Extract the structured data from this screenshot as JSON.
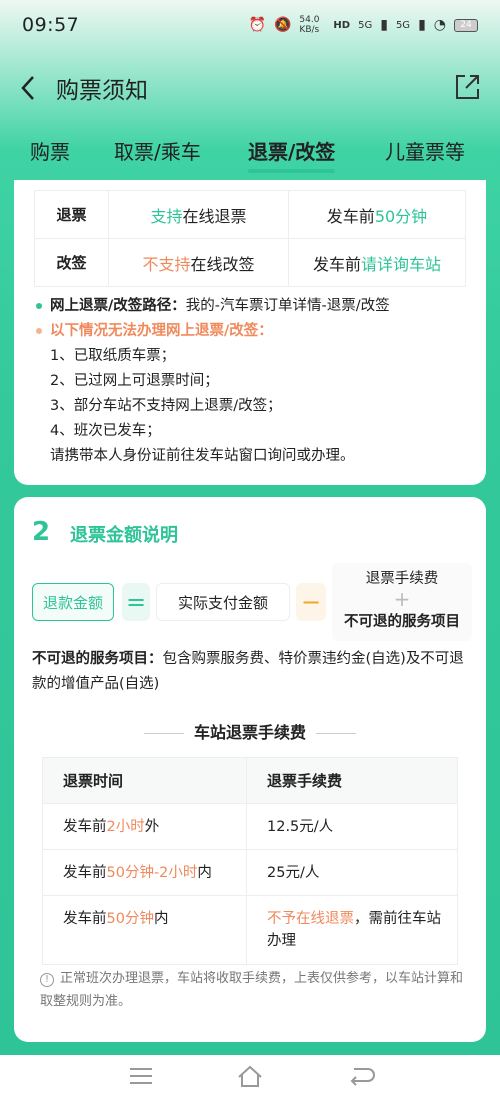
{
  "status": {
    "time": "09:57",
    "speed": "54.0 KB/s",
    "hd": "HD",
    "net1": "5G",
    "net2": "5G",
    "battery": "24"
  },
  "header": {
    "title": "购票须知"
  },
  "tabs": [
    {
      "label": "购票",
      "active": false
    },
    {
      "label": "取票/乘车",
      "active": false
    },
    {
      "label": "退票/改签",
      "active": true
    },
    {
      "label": "儿童票等",
      "active": false
    }
  ],
  "rules": {
    "refund_key": "退票",
    "refund_v1_hl": "支持",
    "refund_v1_rest": "在线退票",
    "refund_v2_pre": "发车前",
    "refund_v2_hl": "50分钟",
    "change_key": "改签",
    "change_v1_hl": "不支持",
    "change_v1_rest": "在线改签",
    "change_v2_pre": "发车前",
    "change_v2_hl": "请详询车站"
  },
  "notes": {
    "path_label": "网上退票/改签路径：",
    "path_value": "我的-汽车票订单详情-退票/改签",
    "cannot_title": "以下情况无法办理网上退票/改签：",
    "items": [
      "1、已取纸质车票；",
      "2、已过网上可退票时间；",
      "3、部分车站不支持网上退票/改签；",
      "4、班次已发车；"
    ],
    "footer": "请携带本人身份证前往发车站窗口询问或办理。"
  },
  "section2": {
    "num": "2",
    "title": "退票金额说明",
    "refund_amount": "退款金额",
    "eq": "=",
    "paid": "实际支付金额",
    "minus": "−",
    "fee": "退票手续费",
    "plus": "+",
    "nonrefundable": "不可退的服务项目",
    "nonref_label": "不可退的服务项目：",
    "nonref_text": "包含购票服务费、特价票违约金(自选)及不可退款的增值产品(自选)",
    "station_fee_title": "车站退票手续费",
    "fee_table": {
      "headers": [
        "退票时间",
        "退票手续费"
      ],
      "rows": [
        {
          "t_pre": "发车前",
          "t_hl": "2小时",
          "t_post": "外",
          "fee_hl": "",
          "fee": "12.5元/人"
        },
        {
          "t_pre": "发车前",
          "t_hl": "50分钟-2小时",
          "t_post": "内",
          "fee_hl": "",
          "fee": "25元/人"
        },
        {
          "t_pre": "发车前",
          "t_hl": "50分钟",
          "t_post": "内",
          "fee_hl": "不予在线退票",
          "fee": "，需前往车站办理"
        }
      ]
    },
    "tip": "正常班次办理退票，车站将收取手续费，上表仅供参考，以车站计算和取整规则为准。"
  }
}
